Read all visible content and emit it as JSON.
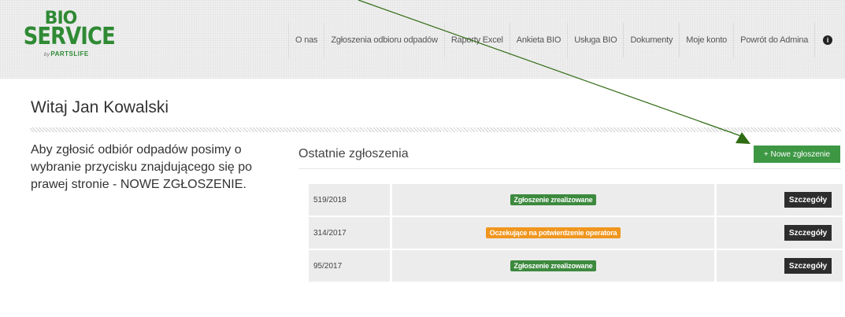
{
  "logo": {
    "line1": "BIO",
    "line2": "SERVICE",
    "by": "by",
    "brand": "PARTSLIFE"
  },
  "nav": {
    "items": [
      "O nas",
      "Zgłoszenia odbioru odpadów",
      "Raporty Excel",
      "Ankieta BIO",
      "Usługa BIO",
      "Dokumenty",
      "Moje konto",
      "Powrót do Admina"
    ],
    "info_icon": "info-icon"
  },
  "main": {
    "greeting": "Witaj Jan Kowalski",
    "intro": "Aby zgłosić odbiór odpadów posimy o wybranie przycisku znajdującego się po prawej stronie - NOWE ZGŁOSZENIE.",
    "recent_title": "Ostatnie zgłoszenia",
    "new_button": "+ Nowe zgłoszenie"
  },
  "requests": [
    {
      "number": "519/2018",
      "status": "Zgłoszenie zrealizowane",
      "status_type": "done",
      "action": "Szczegóły"
    },
    {
      "number": "314/2017",
      "status": "Oczekujące na potwierdzenie operatora",
      "status_type": "pending",
      "action": "Szczegóły"
    },
    {
      "number": "95/2017",
      "status": "Zgłoszenie zrealizowane",
      "status_type": "done",
      "action": "Szczegóły"
    }
  ],
  "colors": {
    "brand_green": "#2f8a34",
    "button_green": "#3d9743",
    "status_done": "#3d8a3f",
    "status_pending": "#f0961e",
    "annotation_arrow": "#2e6b12"
  }
}
